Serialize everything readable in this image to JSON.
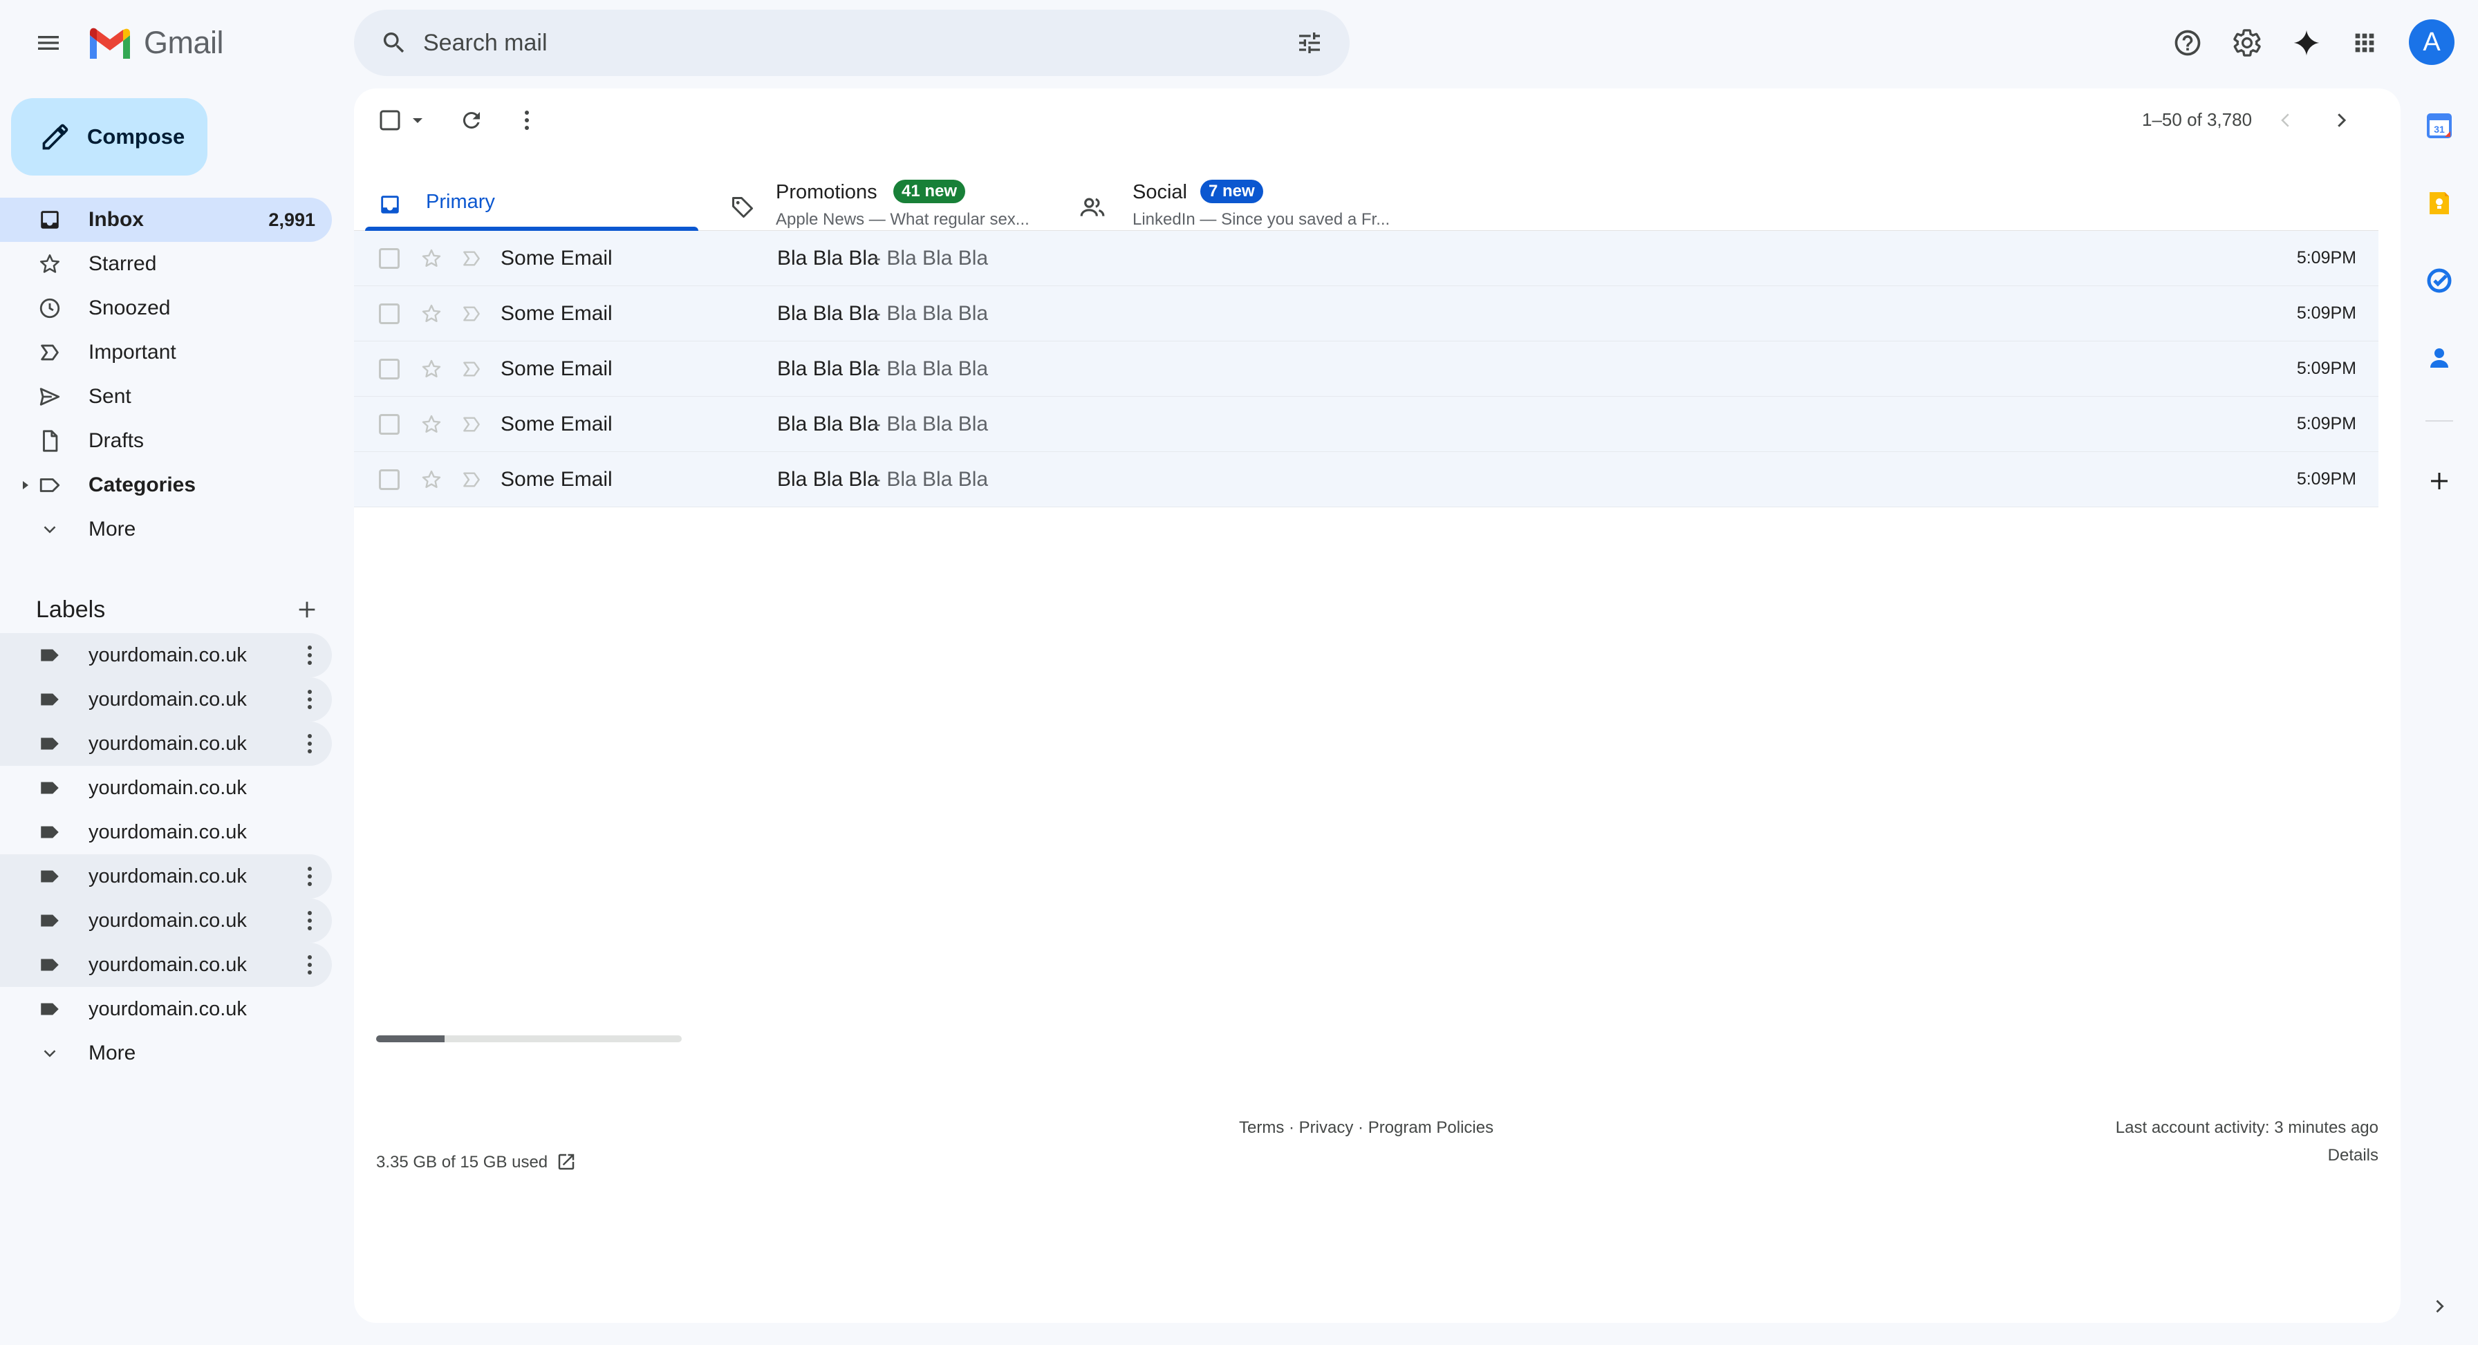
{
  "app": {
    "name": "Gmail"
  },
  "search": {
    "placeholder": "Search mail"
  },
  "account": {
    "avatar_letter": "A",
    "avatar_color": "#1a73e8"
  },
  "compose": {
    "label": "Compose"
  },
  "nav": {
    "items": [
      {
        "label": "Inbox",
        "count": "2,991",
        "icon": "inbox-icon",
        "active": true,
        "bold": true
      },
      {
        "label": "Starred",
        "icon": "star-icon"
      },
      {
        "label": "Snoozed",
        "icon": "clock-icon"
      },
      {
        "label": "Important",
        "icon": "important-icon"
      },
      {
        "label": "Sent",
        "icon": "send-icon"
      },
      {
        "label": "Drafts",
        "icon": "draft-icon"
      },
      {
        "label": "Categories",
        "icon": "label-outline-icon",
        "bold": true
      },
      {
        "label": "More",
        "icon": "chevron-down-icon"
      }
    ]
  },
  "labels": {
    "title": "Labels",
    "items": [
      {
        "label": "yourdomain.co.uk"
      },
      {
        "label": "yourdomain.co.uk"
      },
      {
        "label": "yourdomain.co.uk"
      },
      {
        "label": "yourdomain.co.uk"
      },
      {
        "label": "yourdomain.co.uk"
      },
      {
        "label": "yourdomain.co.uk"
      },
      {
        "label": "yourdomain.co.uk"
      },
      {
        "label": "yourdomain.co.uk"
      },
      {
        "label": "yourdomain.co.uk"
      }
    ],
    "more": "More"
  },
  "toolbar": {
    "pager": "1–50 of 3,780"
  },
  "tabs": [
    {
      "name": "Primary",
      "icon": "inbox-icon",
      "active": true
    },
    {
      "name": "Promotions",
      "badge": "41 new",
      "badge_color": "#188038",
      "subtitle": "Apple News — What regular sex...",
      "icon": "tag-icon"
    },
    {
      "name": "Social",
      "badge": "7 new",
      "badge_color": "#0b57d0",
      "subtitle": "LinkedIn — Since you saved a Fr...",
      "icon": "people-icon"
    }
  ],
  "emails": [
    {
      "sender": "Some Email",
      "subject": "Bla Bla Bla",
      "snippet": "- Bla Bla Bla",
      "time": "5:09PM"
    },
    {
      "sender": "Some Email",
      "subject": "Bla Bla Bla",
      "snippet": "- Bla Bla Bla",
      "time": "5:09PM"
    },
    {
      "sender": "Some Email",
      "subject": "Bla Bla Bla",
      "snippet": "- Bla Bla Bla",
      "time": "5:09PM"
    },
    {
      "sender": "Some Email",
      "subject": "Bla Bla Bla",
      "snippet": "- Bla Bla Bla",
      "time": "5:09PM"
    },
    {
      "sender": "Some Email",
      "subject": "Bla Bla Bla",
      "snippet": "- Bla Bla Bla",
      "time": "5:09PM"
    }
  ],
  "footer": {
    "storage_text": "3.35 GB of 15 GB used",
    "storage_used_fraction": 0.223,
    "terms": "Terms",
    "privacy": "Privacy",
    "policies": "Program Policies",
    "separator": " · ",
    "activity": "Last account activity: 3 minutes ago",
    "details": "Details"
  },
  "side_panel": {
    "calendar_day": "31",
    "apps": [
      "calendar-icon",
      "keep-icon",
      "tasks-icon",
      "contacts-icon",
      "add-icon"
    ]
  }
}
